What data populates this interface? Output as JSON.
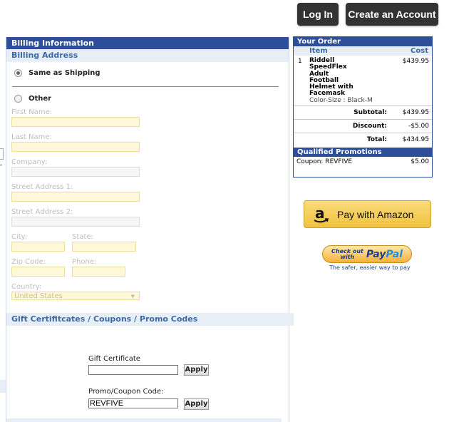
{
  "header": {
    "login_label": "Log In",
    "create_account_label": "Create an Account"
  },
  "billing": {
    "title": "Billing Information",
    "address_title": "Billing Address",
    "same_as_shipping_label": "Same as Shipping",
    "same_as_shipping_selected": true,
    "other_label": "Other",
    "fields": {
      "first_name": "First Name:",
      "last_name": "Last Name:",
      "company": "Company:",
      "street1": "Street Address 1:",
      "street2": "Street Address 2:",
      "city": "City:",
      "state": "State:",
      "zip": "Zip Code:",
      "phone": "Phone:",
      "country": "Country:"
    },
    "country_value": "United States"
  },
  "gift": {
    "title": "Gift Certifitcates / Coupons / Promo Codes",
    "gift_certificate_label": "Gift Certificate",
    "gift_certificate_value": "",
    "promo_label": "Promo/Coupon Code:",
    "promo_value": "REVFIVE",
    "apply_label": "Apply"
  },
  "order": {
    "title": "Your Order",
    "col_item": "Item",
    "col_cost": "Cost",
    "items": [
      {
        "qty": "1",
        "name_lines": [
          "Riddell",
          "SpeedFlex",
          "Adult",
          "Football",
          "Helmet with",
          "Facemask"
        ],
        "variant": "Color-Size : Black-M",
        "price": "$439.95"
      }
    ],
    "subtotal_label": "Subtotal:",
    "subtotal_value": "$439.95",
    "discount_label": "Discount:",
    "discount_value": "-$5.00",
    "total_label": "Total:",
    "total_value": "$434.95",
    "promotions_title": "Qualified Promotions",
    "promotion_label": "Coupon: REVFIVE",
    "promotion_value": "$5.00"
  },
  "payments": {
    "amazon_label": "Pay with Amazon",
    "amazon_icon": "amazon-logo-icon",
    "paypal_checkout_line1": "Check out",
    "paypal_checkout_line2": "with",
    "paypal_logo_part1": "Pay",
    "paypal_logo_part2": "Pal",
    "paypal_tagline": "The safer, easier way to pay"
  },
  "colors": {
    "panel_header": "#2d4f9a",
    "subheader_bg": "#e8eef6",
    "subheader_text": "#3b6aa8",
    "required_field_bg": "#fff8d8",
    "top_button_bg": "#333333"
  }
}
